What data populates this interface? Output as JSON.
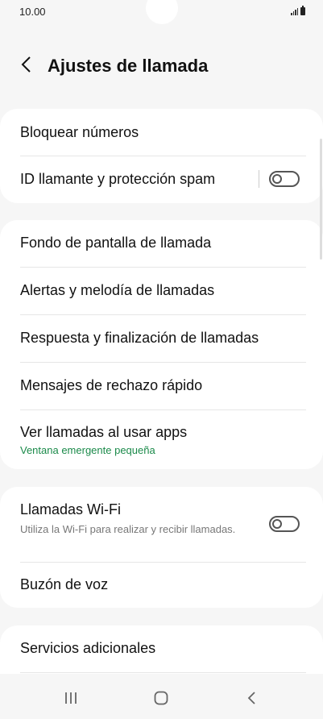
{
  "status_bar": {
    "time": "10.00",
    "signal_icon": "signal-icon",
    "battery_icon": "battery-icon"
  },
  "header": {
    "back_icon": "back-arrow-icon",
    "title": "Ajustes de llamada"
  },
  "group1": {
    "items": [
      {
        "label": "Bloquear números"
      },
      {
        "label": "ID llamante y protección spam",
        "toggle": false
      }
    ]
  },
  "group2": {
    "items": [
      {
        "label": "Fondo de pantalla de llamada"
      },
      {
        "label": "Alertas y melodía de llamadas"
      },
      {
        "label": "Respuesta y finalización de llamadas"
      },
      {
        "label": "Mensajes de rechazo rápido"
      },
      {
        "label": "Ver llamadas al usar apps",
        "subtitle": "Ventana emergente pequeña"
      }
    ]
  },
  "group3": {
    "items": [
      {
        "label": "Llamadas Wi-Fi",
        "subtitle": "Utiliza la Wi-Fi para realizar y recibir llamadas.",
        "toggle": false
      },
      {
        "label": "Buzón de voz"
      }
    ]
  },
  "group4": {
    "items": [
      {
        "label": "Servicios adicionales"
      }
    ]
  },
  "nav_bar": {
    "recents_icon": "recents-icon",
    "home_icon": "home-icon",
    "back_icon": "back-icon"
  }
}
